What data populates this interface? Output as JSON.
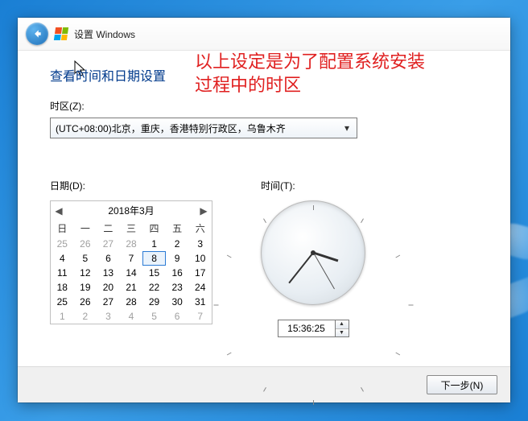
{
  "titlebar": {
    "text": "设置 Windows"
  },
  "annotation": "以上设定是为了配置系统安装\n过程中的时区",
  "heading": "查看时间和日期设置",
  "timezone": {
    "label": "时区(Z):",
    "selected": "(UTC+08:00)北京，重庆，香港特别行政区，乌鲁木齐"
  },
  "date": {
    "label": "日期(D):",
    "month_title": "2018年3月",
    "dow": [
      "日",
      "一",
      "二",
      "三",
      "四",
      "五",
      "六"
    ],
    "cells": [
      {
        "n": 25,
        "other": true
      },
      {
        "n": 26,
        "other": true
      },
      {
        "n": 27,
        "other": true
      },
      {
        "n": 28,
        "other": true
      },
      {
        "n": 1
      },
      {
        "n": 2
      },
      {
        "n": 3
      },
      {
        "n": 4
      },
      {
        "n": 5
      },
      {
        "n": 6
      },
      {
        "n": 7
      },
      {
        "n": 8,
        "sel": true
      },
      {
        "n": 9
      },
      {
        "n": 10
      },
      {
        "n": 11
      },
      {
        "n": 12
      },
      {
        "n": 13
      },
      {
        "n": 14
      },
      {
        "n": 15
      },
      {
        "n": 16
      },
      {
        "n": 17
      },
      {
        "n": 18
      },
      {
        "n": 19
      },
      {
        "n": 20
      },
      {
        "n": 21
      },
      {
        "n": 22
      },
      {
        "n": 23
      },
      {
        "n": 24
      },
      {
        "n": 25
      },
      {
        "n": 26
      },
      {
        "n": 27
      },
      {
        "n": 28
      },
      {
        "n": 29
      },
      {
        "n": 30
      },
      {
        "n": 31
      },
      {
        "n": 1,
        "other": true
      },
      {
        "n": 2,
        "other": true
      },
      {
        "n": 3,
        "other": true
      },
      {
        "n": 4,
        "other": true
      },
      {
        "n": 5,
        "other": true
      },
      {
        "n": 6,
        "other": true
      },
      {
        "n": 7,
        "other": true
      }
    ]
  },
  "time": {
    "label": "时间(T):",
    "value": "15:36:25",
    "h": 15,
    "m": 36,
    "s": 25
  },
  "footer": {
    "next": "下一步(N)"
  }
}
